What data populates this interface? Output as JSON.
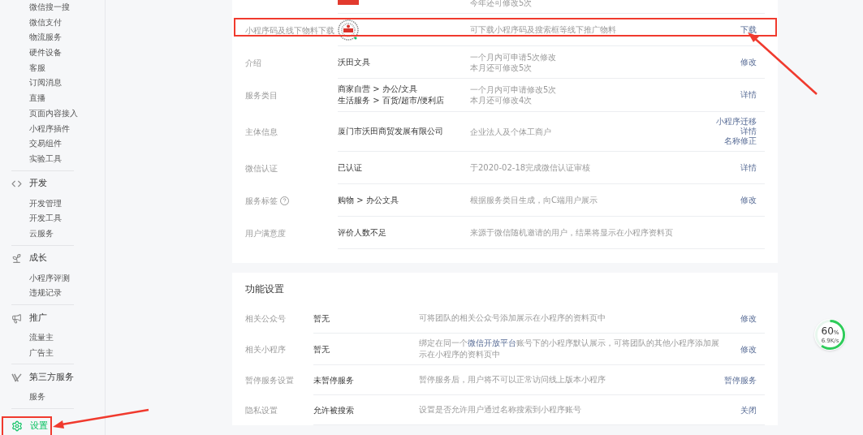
{
  "sidebar": {
    "groups": [
      {
        "items": [
          {
            "label": "微信搜一搜",
            "selected": false
          },
          {
            "label": "微信支付",
            "selected": false
          },
          {
            "label": "物流服务",
            "selected": false
          },
          {
            "label": "硬件设备",
            "selected": false
          },
          {
            "label": "客服",
            "selected": false
          },
          {
            "label": "订阅消息",
            "selected": false
          },
          {
            "label": "直播",
            "selected": false
          },
          {
            "label": "页面内容接入",
            "selected": false
          },
          {
            "label": "小程序插件",
            "selected": false
          },
          {
            "label": "交易组件",
            "selected": false
          },
          {
            "label": "实验工具",
            "selected": false
          }
        ]
      },
      {
        "title": "开发",
        "selected": false,
        "items": [
          {
            "label": "开发管理",
            "selected": false
          },
          {
            "label": "开发工具",
            "selected": false
          },
          {
            "label": "云服务",
            "selected": false
          }
        ]
      },
      {
        "title": "成长",
        "selected": false,
        "items": [
          {
            "label": "小程序评测",
            "selected": false
          },
          {
            "label": "违规记录",
            "selected": false
          }
        ]
      },
      {
        "title": "推广",
        "selected": false,
        "items": [
          {
            "label": "流量主",
            "selected": false
          },
          {
            "label": "广告主",
            "selected": false
          }
        ]
      },
      {
        "title": "第三方服务",
        "selected": false,
        "items": [
          {
            "label": "服务",
            "selected": false
          }
        ]
      },
      {
        "title": "设置",
        "selected": true
      }
    ]
  },
  "basic_info": {
    "rows": [
      {
        "kind": "logo",
        "label": "",
        "desc": [
          "今年还可修改5次"
        ],
        "actions": []
      },
      {
        "kind": "qrcode",
        "label": "小程序码及线下物料下载",
        "desc": [
          "可下载小程序码及搜索框等线下推广物料"
        ],
        "actions": [
          "下载"
        ]
      },
      {
        "kind": "text",
        "label": "介绍",
        "value": [
          "沃田文具"
        ],
        "desc": [
          "一个月内可申请5次修改",
          "本月还可修改5次"
        ],
        "actions": [
          "修改"
        ]
      },
      {
        "kind": "text",
        "label": "服务类目",
        "value": [
          "商家自营 > 办公/文具",
          "生活服务 > 百货/超市/便利店"
        ],
        "desc": [
          "一个月内可申请修改5次",
          "本月还可修改4次"
        ],
        "actions": [
          "详情"
        ]
      },
      {
        "kind": "text",
        "label": "主体信息",
        "value": [
          "厦门市沃田商贸发展有限公司"
        ],
        "desc": [
          "企业法人及个体工商户"
        ],
        "actions": [
          "小程序迁移",
          "详情",
          "名称修正"
        ]
      },
      {
        "kind": "text",
        "label": "微信认证",
        "value": [
          "已认证"
        ],
        "desc": [
          "于2020-02-18完成微信认证审核"
        ],
        "actions": [
          "详情"
        ]
      },
      {
        "kind": "text",
        "label": "服务标签",
        "help": true,
        "value": [
          "购物 > 办公文具"
        ],
        "desc": [
          "根据服务类目生成，向C端用户展示"
        ],
        "actions": [
          "修改"
        ]
      },
      {
        "kind": "text",
        "label": "用户满意度",
        "value": [
          "评价人数不足"
        ],
        "desc": [
          "来源于微信随机邀请的用户，结果将显示在小程序资料页"
        ],
        "actions": []
      }
    ]
  },
  "feature_settings": {
    "title": "功能设置",
    "rows": [
      {
        "label": "相关公众号",
        "value": "暂无",
        "desc": [
          {
            "kind": "text",
            "text": "可将团队的相关公众号添加展示在小程序的资料页中"
          }
        ],
        "action": "修改"
      },
      {
        "label": "相关小程序",
        "value": "暂无",
        "desc": [
          {
            "kind": "text",
            "text": "绑定在同一个"
          },
          {
            "kind": "link",
            "text": "微信开放平台"
          },
          {
            "kind": "text",
            "text": "账号下的小程序默认展示，可将团队的其他小程序添加展示在小程序的资料页中"
          }
        ],
        "action": "修改"
      },
      {
        "label": "暂停服务设置",
        "value": "未暂停服务",
        "desc": [
          {
            "kind": "text",
            "text": "暂停服务后，用户将不可以正常访问线上版本小程序"
          }
        ],
        "action": "暂停服务"
      },
      {
        "label": "隐私设置",
        "value": "允许被搜索",
        "desc": [
          {
            "kind": "text",
            "text": "设置是否允许用户通过名称搜索到小程序账号"
          }
        ],
        "action": "关闭"
      }
    ]
  },
  "speed_widget": {
    "percent": "60",
    "unit": "%",
    "speed": "6.9K/s",
    "level": 0.6
  }
}
